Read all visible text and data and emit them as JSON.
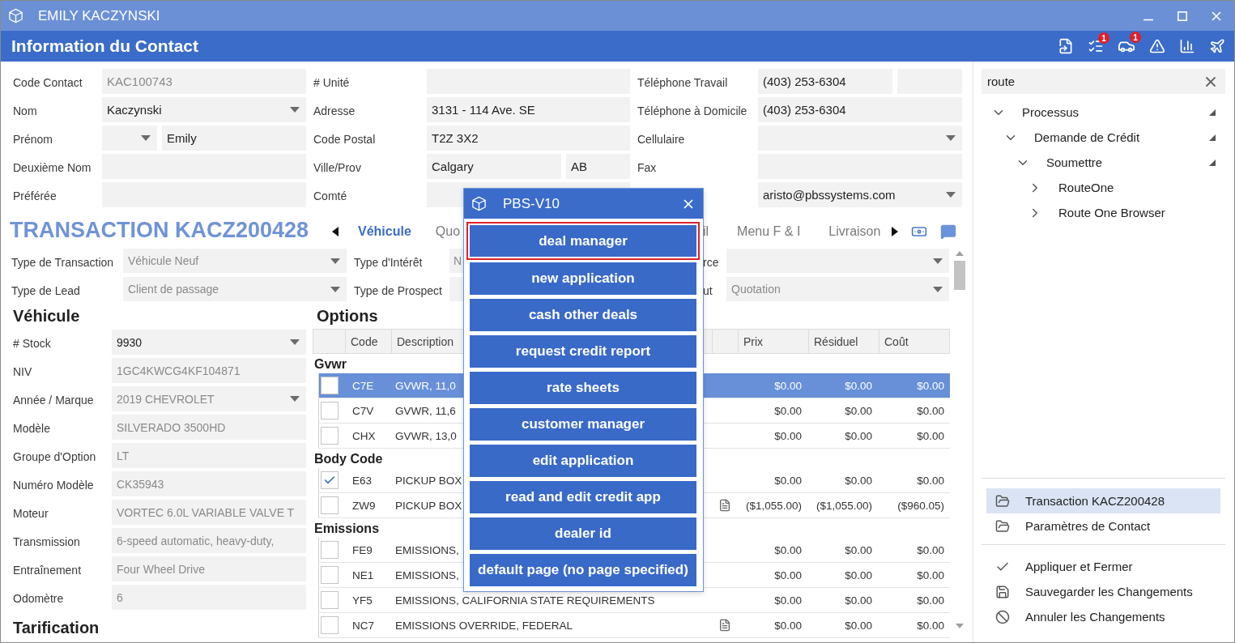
{
  "window": {
    "title": "EMILY KACZYNSKI"
  },
  "header": {
    "title": "Information du Contact",
    "list_badge": "1",
    "car_badge": "1"
  },
  "contact": {
    "columns": [
      {
        "rows": [
          {
            "label": "Code Contact",
            "fields": [
              {
                "kind": "text",
                "value": "KAC100743",
                "disabled": true
              }
            ]
          },
          {
            "label": "Nom",
            "fields": [
              {
                "kind": "dropdown",
                "value": "Kaczynski",
                "disabled": false
              }
            ]
          },
          {
            "label": "Prénom",
            "fields": [
              {
                "kind": "title-dropdown"
              },
              {
                "kind": "text",
                "value": "Emily",
                "disabled": false
              }
            ]
          },
          {
            "label": "Deuxième Nom",
            "fields": [
              {
                "kind": "text"
              }
            ]
          },
          {
            "label": "Préférée",
            "fields": [
              {
                "kind": "text"
              }
            ]
          }
        ]
      },
      {
        "rows": [
          {
            "label": "# Unité",
            "fields": [
              {
                "kind": "text"
              }
            ]
          },
          {
            "label": "Adresse",
            "fields": [
              {
                "kind": "text",
                "value": "3131 - 114 Ave. SE",
                "disabled": false
              }
            ]
          },
          {
            "label": "Code Postal",
            "fields": [
              {
                "kind": "text",
                "value": "T2Z 3X2",
                "disabled": false
              }
            ]
          },
          {
            "label": "Ville/Prov",
            "fields": [
              {
                "kind": "text",
                "value": "Calgary",
                "disabled": false
              },
              {
                "kind": "province",
                "value": "AB",
                "disabled": false
              }
            ]
          },
          {
            "label": "Comté",
            "fields": [
              {
                "kind": "text"
              }
            ]
          }
        ]
      },
      {
        "rows": [
          {
            "label": "Téléphone Travail",
            "fields": [
              {
                "kind": "text",
                "value": "(403) 253-6304",
                "disabled": false
              },
              {
                "kind": "extension"
              }
            ]
          },
          {
            "label": "Téléphone à Domicile",
            "fields": [
              {
                "kind": "text",
                "value": "(403) 253-6304",
                "disabled": false
              }
            ]
          },
          {
            "label": "Cellulaire",
            "fields": [
              {
                "kind": "dropdown"
              }
            ]
          },
          {
            "label": "Fax",
            "fields": [
              {
                "kind": "text"
              }
            ]
          },
          {
            "fields": [
              {
                "kind": "dropdown",
                "value": "aristo@pbssystems.com",
                "disabled": false
              }
            ]
          }
        ]
      }
    ]
  },
  "transaction": {
    "title": "TRANSACTION KACZ200428",
    "tabs": [
      {
        "label": "Véhicule",
        "selected": true
      },
      {
        "label": "Quo",
        "selected": false
      },
      {
        "label": "il",
        "selected": false
      },
      {
        "label": "Menu F & I",
        "selected": false
      },
      {
        "label": "Livraison",
        "selected": false
      }
    ],
    "rows": [
      [
        {
          "label": "Type de Transaction",
          "kind": "dropdown",
          "value": "Véhicule Neuf",
          "disabled": true
        },
        {
          "label": "Type d'Intérêt",
          "kind": "text",
          "value": "N",
          "disabled": true
        },
        {
          "label": "rce",
          "kind": "dropdown"
        }
      ],
      [
        {
          "label": "Type de Lead",
          "kind": "dropdown",
          "value": "Client de passage",
          "disabled": true
        },
        {
          "label": "Type de Prospect",
          "kind": "text"
        },
        {
          "label": "ut",
          "kind": "dropdown",
          "value": "Quotation",
          "disabled": true
        }
      ]
    ]
  },
  "vehicle": {
    "title": "Véhicule",
    "fields": [
      {
        "label": "# Stock",
        "kind": "dropdown",
        "value": "9930",
        "disabled": false
      },
      {
        "label": "NIV",
        "kind": "text",
        "value": "1GC4KWCG4KF104871",
        "disabled": true
      },
      {
        "label": "Année / Marque",
        "kind": "dropdown",
        "value": "2019 CHEVROLET",
        "disabled": true
      },
      {
        "label": "Modèle",
        "kind": "text",
        "value": "SILVERADO 3500HD",
        "disabled": true
      },
      {
        "label": "Groupe d'Option",
        "kind": "text",
        "value": "LT",
        "disabled": true
      },
      {
        "label": "Numéro Modèle",
        "kind": "text",
        "value": "CK35943",
        "disabled": true
      },
      {
        "label": "Moteur",
        "kind": "text",
        "value": "VORTEC 6.0L VARIABLE VALVE T",
        "disabled": true
      },
      {
        "label": "Transmission",
        "kind": "text",
        "value": "6-speed automatic, heavy-duty,",
        "disabled": true
      },
      {
        "label": "Entraînement",
        "kind": "text",
        "value": "Four Wheel Drive",
        "disabled": true
      },
      {
        "label": "Odomètre",
        "kind": "text",
        "value": "6",
        "disabled": true
      }
    ]
  },
  "pricing": {
    "title": "Tarification"
  },
  "options": {
    "title": "Options",
    "columns": [
      "Code",
      "Description",
      "Prix",
      "Résiduel",
      "Coût"
    ],
    "groups": [
      {
        "name": "Gvwr",
        "rows": [
          {
            "code": "C7E",
            "description": "GVWR, 11,0",
            "amounts": [
              "$0.00",
              "$0.00",
              "$0.00"
            ],
            "checked": false,
            "selected": true,
            "note": false
          },
          {
            "code": "C7V",
            "description": "GVWR, 11,6",
            "amounts": [
              "$0.00",
              "$0.00",
              "$0.00"
            ],
            "checked": false,
            "selected": false,
            "note": false
          },
          {
            "code": "CHX",
            "description": "GVWR, 13,0",
            "amounts": [
              "$0.00",
              "$0.00",
              "$0.00"
            ],
            "checked": false,
            "selected": false,
            "note": false
          }
        ]
      },
      {
        "name": "Body Code",
        "rows": [
          {
            "code": "E63",
            "description": "PICKUP BOX",
            "amounts": [
              "$0.00",
              "$0.00",
              "$0.00"
            ],
            "checked": true,
            "selected": false,
            "note": false
          },
          {
            "code": "ZW9",
            "description": "PICKUP BOX",
            "amounts": [
              "($1,055.00)",
              "($1,055.00)",
              "($960.05)"
            ],
            "checked": false,
            "selected": false,
            "note": true
          }
        ]
      },
      {
        "name": "Emissions",
        "rows": [
          {
            "code": "FE9",
            "description": "EMISSIONS,",
            "amounts": [
              "$0.00",
              "$0.00",
              "$0.00"
            ],
            "checked": false,
            "selected": false,
            "note": false
          },
          {
            "code": "NE1",
            "description": "EMISSIONS,",
            "amounts": [
              "$0.00",
              "$0.00",
              "$0.00"
            ],
            "checked": false,
            "selected": false,
            "note": false
          },
          {
            "code": "YF5",
            "description": "EMISSIONS, CALIFORNIA STATE REQUIREMENTS",
            "amounts": [
              "$0.00",
              "$0.00",
              "$0.00"
            ],
            "checked": false,
            "selected": false,
            "note": false
          },
          {
            "code": "NC7",
            "description": "EMISSIONS OVERRIDE, FEDERAL",
            "amounts": [
              "$0.00",
              "$0.00",
              "$0.00"
            ],
            "checked": false,
            "selected": false,
            "note": true
          }
        ]
      }
    ]
  },
  "sidebar": {
    "search": {
      "value": "route"
    },
    "tree": [
      {
        "label": "Processus",
        "expanded": true,
        "children": [
          {
            "label": "Demande de Crédit",
            "expanded": true,
            "children": [
              {
                "label": "Soumettre",
                "expanded": true,
                "children": [
                  {
                    "label": "RouteOne",
                    "expanded": false
                  },
                  {
                    "label": "Route One Browser",
                    "expanded": false
                  }
                ]
              }
            ]
          }
        ]
      }
    ],
    "links": [
      {
        "label": "Transaction KACZ200428",
        "selected": true
      },
      {
        "label": "Paramètres de Contact",
        "selected": false
      }
    ],
    "actions": [
      {
        "label": "Appliquer et Fermer"
      },
      {
        "label": "Sauvegarder les Changements"
      },
      {
        "label": "Annuler les Changements"
      }
    ]
  },
  "dialog": {
    "title": "PBS-V10",
    "buttons": [
      {
        "label": "deal manager",
        "focused": true
      },
      {
        "label": "new application",
        "focused": false
      },
      {
        "label": "cash other deals",
        "focused": false
      },
      {
        "label": "request credit report",
        "focused": false
      },
      {
        "label": "rate sheets",
        "focused": false
      },
      {
        "label": "customer manager",
        "focused": false
      },
      {
        "label": "edit application",
        "focused": false
      },
      {
        "label": "read and edit credit app",
        "focused": false
      },
      {
        "label": "dealer id",
        "focused": false
      },
      {
        "label": "default page (no page specified)",
        "focused": false
      }
    ]
  }
}
